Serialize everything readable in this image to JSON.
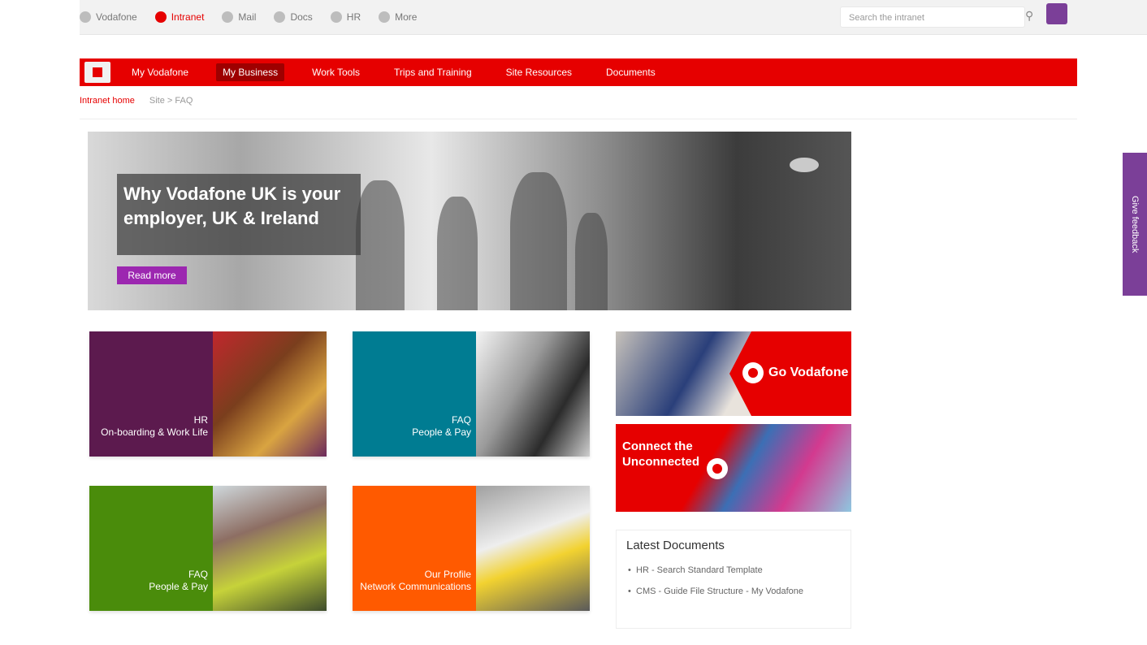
{
  "topbar": {
    "apps": [
      {
        "label": "Vodafone",
        "icon": "grid-icon",
        "active": false
      },
      {
        "label": "Intranet",
        "icon": "home-icon",
        "active": true
      },
      {
        "label": "Mail",
        "icon": "mail-icon",
        "active": false
      },
      {
        "label": "Docs",
        "icon": "doc-icon",
        "active": false
      },
      {
        "label": "HR",
        "icon": "people-icon",
        "active": false
      },
      {
        "label": "More",
        "icon": "more-icon",
        "active": false
      }
    ],
    "search_placeholder": "Search the intranet",
    "search_icon": "search-icon"
  },
  "nav": {
    "home_icon": "home-icon",
    "items": [
      {
        "label": "My Vodafone",
        "active": false
      },
      {
        "label": "My Business",
        "active": true
      },
      {
        "label": "Work Tools",
        "active": false
      },
      {
        "label": "Trips and Training",
        "active": false
      },
      {
        "label": "Site Resources",
        "active": false
      },
      {
        "label": "Documents",
        "active": false
      }
    ]
  },
  "breadcrumb": {
    "items": [
      "Intranet home",
      "Site > FAQ"
    ]
  },
  "hero": {
    "title": "Why Vodafone UK is your employer, UK & Ireland",
    "tag": "Read more"
  },
  "tiles": [
    {
      "text": "HR\nOn-boarding & Work Life",
      "panel_color": "#5c1a4e"
    },
    {
      "text": "FAQ\nPeople & Pay",
      "panel_color": "#007c92"
    },
    {
      "text": "FAQ\nPeople & Pay",
      "panel_color": "#4a8c0b"
    },
    {
      "text": "Our Profile\nNetwork Communications",
      "panel_color": "#ff5a00"
    }
  ],
  "promos": [
    {
      "text": "Go Vodafone",
      "accent": "#e60000"
    },
    {
      "text": "Connect the Unconnected",
      "accent": "#e60000"
    }
  ],
  "latest": {
    "title": "Latest Documents",
    "items": [
      "HR - Search Standard Template",
      "CMS - Guide File Structure - My Vodafone"
    ]
  },
  "side_tab": {
    "label": "Give feedback"
  },
  "colors": {
    "brand_red": "#e60000",
    "accent_purple": "#7b3f98"
  }
}
